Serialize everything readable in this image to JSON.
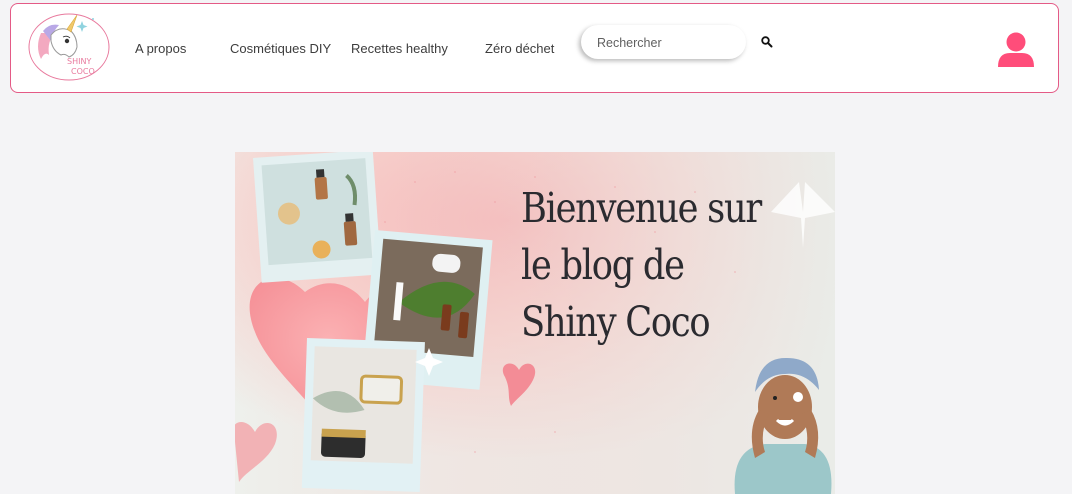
{
  "header": {
    "logo_text_line1": "SHINY",
    "logo_text_line2": "COCO",
    "nav": [
      {
        "label": "A propos"
      },
      {
        "label": "Cosmétiques DIY"
      },
      {
        "label": "Recettes healthy"
      },
      {
        "label": "Zéro déchet"
      }
    ],
    "search": {
      "placeholder": "Rechercher",
      "value": ""
    },
    "icons": {
      "search": "magnifier-icon",
      "account": "user-icon"
    }
  },
  "banner": {
    "headline": [
      "Bienvenue sur",
      "le blog de",
      "Shiny Coco"
    ]
  },
  "colors": {
    "accent": "#ff4d7a",
    "header_border": "#e45a86",
    "page_bg": "#f4f4f6"
  }
}
